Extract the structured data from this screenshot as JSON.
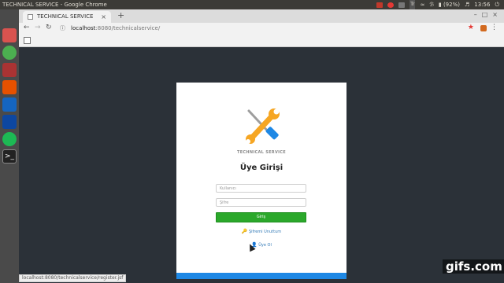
{
  "os": {
    "window_title": "TECHNICAL SERVICE - Google Chrome",
    "battery": "(92%)",
    "clock": "13:56",
    "keyboard": "Tr",
    "launcher_icons": [
      "dash-icon",
      "files-icon",
      "chrome-icon",
      "browser-red-icon",
      "editor-icon",
      "app-blue-icon",
      "app-terminal-blue-icon",
      "spotify-icon",
      "terminal-icon"
    ]
  },
  "browser": {
    "tab_title": "TECHNICAL SERVICE",
    "new_tab": "+",
    "address_host": "localhost",
    "address_rest": ":8080/technicalservice/",
    "status_url": "localhost:8080/technicalservice/register.jsf"
  },
  "page": {
    "brand": "TECHNICAL SERVICE",
    "heading": "Üye Girişi",
    "username_placeholder": "Kullanıcı",
    "password_placeholder": "Şifre",
    "login_label": "Giriş",
    "forgot_label": "Şifremi Unuttum",
    "register_label": "Üye Ol"
  },
  "colors": {
    "login_green": "#2ba82b",
    "footer_blue": "#1e88e5",
    "link_blue": "#337ab7"
  },
  "watermark": "gifs.com"
}
